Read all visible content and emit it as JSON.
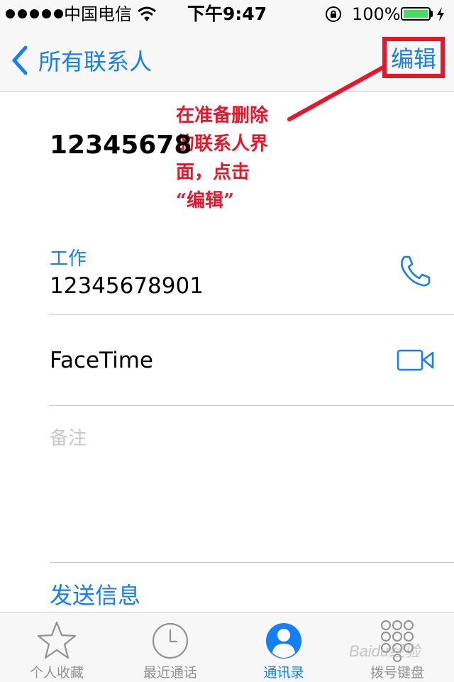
{
  "status_bar": {
    "carrier": "中国电信",
    "time": "下午9:47",
    "battery_percent": "100%",
    "battery_level": 1.0,
    "battery_color": "#4cd964"
  },
  "nav": {
    "back_label": "所有联系人",
    "edit_label": "编辑",
    "accent_color": "#147efb"
  },
  "annotation": {
    "lines": [
      "在准备删除",
      "的联系人界",
      "面，点击",
      "“编辑”"
    ],
    "color": "#e8162a"
  },
  "contact": {
    "name": "12345678",
    "phone_label": "工作",
    "phone_number": "12345678901",
    "facetime_label": "FaceTime",
    "notes_label": "备注",
    "send_message_label": "发送信息"
  },
  "tab_bar": {
    "tabs": [
      {
        "label": "个人收藏",
        "icon": "star-icon"
      },
      {
        "label": "最近通话",
        "icon": "clock-icon"
      },
      {
        "label": "通讯录",
        "icon": "person-icon",
        "active": true
      },
      {
        "label": "拨号键盘",
        "icon": "keypad-icon"
      }
    ]
  },
  "watermark": "Baidu经验"
}
